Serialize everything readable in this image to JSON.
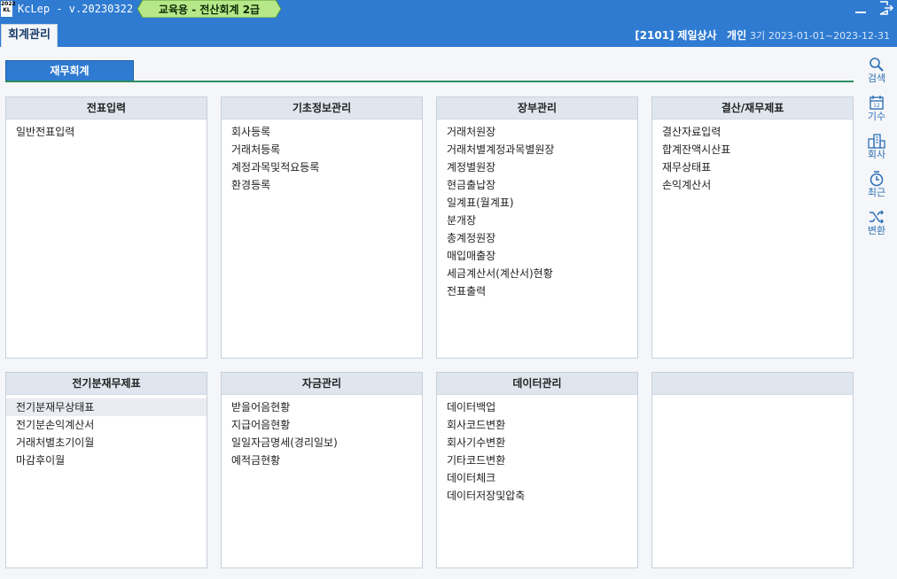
{
  "titlebar": {
    "logo_text": "2022 KL",
    "app_title": "KcLep - v.20230322",
    "edu_badge": "교육용 - 전산회계 2급"
  },
  "menustrip": {
    "tab_label": "회계관리",
    "company_code": "[2101]",
    "company_name": "제일상사",
    "company_type": "개인",
    "fiscal_term": "3기",
    "fiscal_period": "2023-01-01~2023-12-31"
  },
  "section": {
    "tab_label": "재무회계"
  },
  "panels": [
    {
      "title": "전표입력",
      "items": [
        "일반전표입력"
      ]
    },
    {
      "title": "기초정보관리",
      "items": [
        "회사등록",
        "거래처등록",
        "계정과목및적요등록",
        "환경등록"
      ]
    },
    {
      "title": "장부관리",
      "items": [
        "거래처원장",
        "거래처별계정과목별원장",
        "계정별원장",
        "현금출납장",
        "일계표(월계표)",
        "분개장",
        "총계정원장",
        "매입매출장",
        "세금계산서(계산서)현황",
        "전표출력"
      ]
    },
    {
      "title": "결산/재무제표",
      "items": [
        "결산자료입력",
        "합계잔액시산표",
        "재무상태표",
        "손익계산서"
      ]
    },
    {
      "title": "전기분재무제표",
      "items": [
        "전기분재무상태표",
        "전기분손익계산서",
        "거래처별초기이월",
        "마감후이월"
      ]
    },
    {
      "title": "자금관리",
      "items": [
        "받을어음현황",
        "지급어음현황",
        "일일자금명세(경리일보)",
        "예적금현황"
      ]
    },
    {
      "title": "데이터관리",
      "items": [
        "데이터백업",
        "회사코드변환",
        "회사기수변환",
        "기타코드변환",
        "데이터체크",
        "데이터저장및압축"
      ]
    },
    {
      "title": "",
      "items": []
    }
  ],
  "toolbar": [
    {
      "label": "검색",
      "icon": "search-icon"
    },
    {
      "label": "기수",
      "icon": "calendar-icon"
    },
    {
      "label": "회사",
      "icon": "building-icon"
    },
    {
      "label": "최근",
      "icon": "clock-icon"
    },
    {
      "label": "변환",
      "icon": "shuffle-icon"
    }
  ],
  "colors": {
    "accent": "#2f7bd2",
    "badge": "#a8e07a",
    "divider": "#2e8d5f"
  }
}
